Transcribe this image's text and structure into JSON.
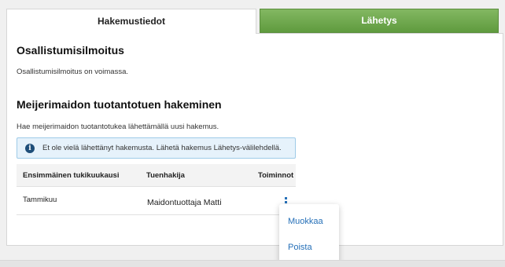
{
  "tabs": {
    "active_label": "Hakemustiedot",
    "second_label": "Lähetys"
  },
  "section1": {
    "title": "Osallistumisilmoitus",
    "text": "Osallistumisilmoitus on voimassa."
  },
  "section2": {
    "title": "Meijerimaidon tuotantotuen hakeminen",
    "text": "Hae meijerimaidon tuotantotukea lähettämällä uusi hakemus."
  },
  "notice": {
    "icon": "info-icon",
    "icon_glyph": "i",
    "text": "Et ole vielä lähettänyt hakemusta. Lähetä hakemus Lähetys-välilehdellä."
  },
  "table": {
    "headers": [
      "Ensimmäinen tukikuukausi",
      "Tuenhakija",
      "Toiminnot"
    ],
    "rows": [
      {
        "month": "Tammikuu",
        "applicant": "Maidontuottaja Matti"
      }
    ]
  },
  "menu": {
    "items": [
      "Muokkaa",
      "Poista"
    ]
  },
  "colors": {
    "accent_green": "#71a94f",
    "link_blue": "#2670b8",
    "info_bg": "#e6f2fb"
  }
}
